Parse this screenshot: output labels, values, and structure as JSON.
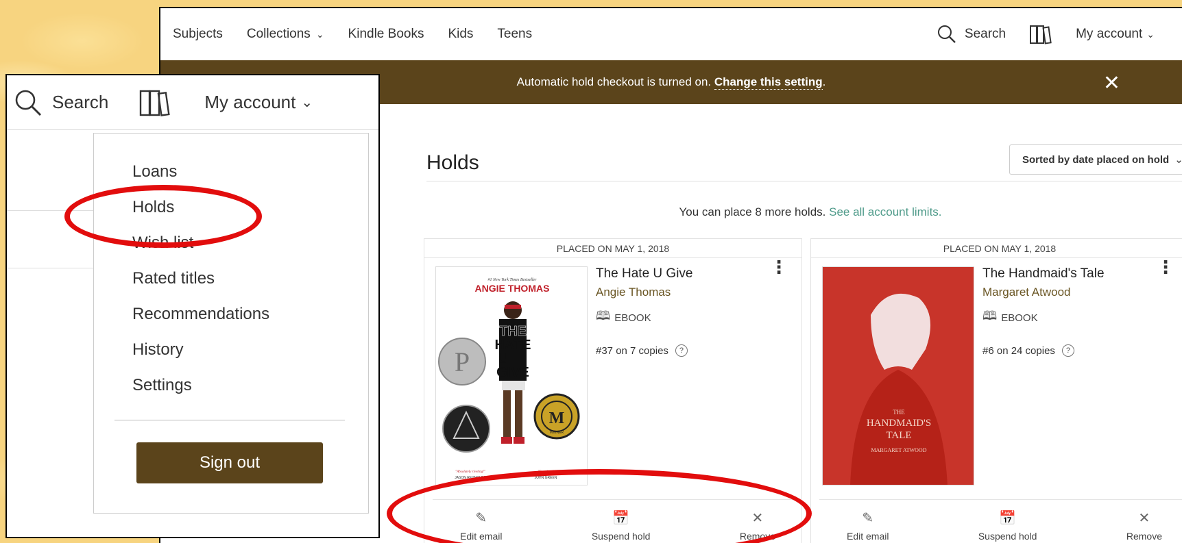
{
  "colors": {
    "brand_brown": "#5b441b",
    "link_teal": "#4f9b8a",
    "highlight_red": "#e20d0d",
    "backdrop": "#f7d480"
  },
  "nav": {
    "items": [
      {
        "label": "Subjects"
      },
      {
        "label": "Collections",
        "icon": "chevron-down-icon"
      },
      {
        "label": "Kindle Books"
      },
      {
        "label": "Kids"
      },
      {
        "label": "Teens"
      }
    ],
    "search_label": "Search",
    "account_label": "My account"
  },
  "banner": {
    "text": "Automatic hold checkout is turned on.",
    "link": "Change this setting",
    "period": "."
  },
  "holds": {
    "title": "Holds",
    "sort_label": "Sorted by date placed on hold",
    "limits_text": "You can place 8 more holds.",
    "limits_link": "See all account limits."
  },
  "cards": [
    {
      "placed": "PLACED ON MAY 1, 2018",
      "title": "The Hate U Give",
      "author": "Angie Thomas",
      "format": "EBOOK",
      "queue": "#37 on 7 copies",
      "cover": {
        "bestseller": "#1 New York Times Bestseller",
        "author": "ANGIE THOMAS",
        "title_lines": [
          "THE",
          "HATE",
          "U",
          "GIVE"
        ],
        "badge": "M",
        "badge_sub": "WINNER",
        "quote_left": "\"Absolutely riveting!\"",
        "quote_left_by": "JASON REYNOLDS",
        "quote_right": "\"Stunning.\"",
        "quote_right_by": "JOHN GREEN"
      }
    },
    {
      "placed": "PLACED ON MAY 1, 2018",
      "title": "The Handmaid's Tale",
      "author": "Margaret Atwood",
      "format": "EBOOK",
      "queue": "#6 on 24 copies",
      "cover": {
        "the": "THE",
        "title_lines": [
          "HANDMAID'S",
          "TALE"
        ],
        "author": "MARGARET ATWOOD"
      }
    }
  ],
  "actions": [
    {
      "label": "Edit email",
      "icon": "edit-icon"
    },
    {
      "label": "Suspend hold",
      "icon": "calendar-icon"
    },
    {
      "label": "Remove",
      "icon": "close-icon"
    }
  ],
  "zoom": {
    "search_label": "Search",
    "account_label": "My account",
    "menu": [
      "Loans",
      "Holds",
      "Wish list",
      "Rated titles",
      "Recommendations",
      "History",
      "Settings"
    ],
    "signout": "Sign out"
  }
}
